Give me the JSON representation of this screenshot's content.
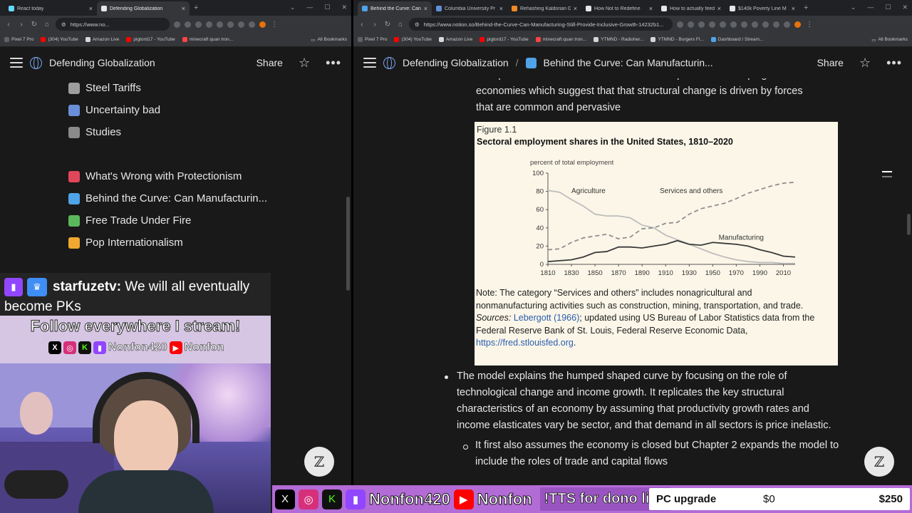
{
  "left_browser": {
    "tabs": [
      {
        "title": "React today",
        "color": "#61dafb",
        "active": false
      },
      {
        "title": "Defending Globalization",
        "color": "#e6e6e6",
        "active": true
      }
    ],
    "url": "https://www.no...",
    "bookmarks": [
      "Pixel 7 Pro",
      "(304) YouTube",
      "Amazon Live",
      "pigtord17 - YouTube",
      "minecraft quan tron..."
    ],
    "all_bookmarks": "All Bookmarks"
  },
  "right_browser": {
    "tabs": [
      {
        "title": "Behind the Curve: Can",
        "color": "#4fa3e8",
        "active": true
      },
      {
        "title": "Columbia University Pr",
        "color": "#5f8fd8",
        "active": false
      },
      {
        "title": "Rehashing Kaldorian G",
        "color": "#f08a24",
        "active": false
      },
      {
        "title": "How Not to Redefine",
        "color": "#e6e6e6",
        "active": false
      },
      {
        "title": "How to actually feed A",
        "color": "#e6e6e6",
        "active": false
      },
      {
        "title": "$140k Poverty Line M",
        "color": "#e6e6e6",
        "active": false
      }
    ],
    "url": "https://www.notion.so/Behind-the-Curve-Can-Manufacturing-Still-Provide-Inclusive-Growth-14232b1...",
    "bookmarks": [
      "Pixel 7 Pro",
      "(304) YouTube",
      "Amazon Live",
      "pigtord17 - YouTube",
      "minecraft quan tron...",
      "YTMND - Radioher...",
      "YTMND - Burgers Fl...",
      "Dashboard / Stream..."
    ],
    "all_bookmarks": "All Bookmarks"
  },
  "left_notion": {
    "header": {
      "title": "Defending Globalization",
      "share": "Share"
    },
    "nav": [
      {
        "label": "Steel Tariffs",
        "icon": "chain-icon",
        "color": "#9e9e9e"
      },
      {
        "label": "Uncertainty bad",
        "icon": "bar-chart-icon",
        "color": "#6a8fd8"
      },
      {
        "label": "Studies",
        "icon": "checker-icon",
        "color": "#8a8a8a"
      },
      {
        "label": "What's Wrong with Protectionism",
        "icon": "red-book-icon",
        "color": "#e0475a"
      },
      {
        "label": "Behind the Curve: Can Manufacturin...",
        "icon": "blue-book-icon",
        "color": "#4fa3e8"
      },
      {
        "label": "Free Trade Under Fire",
        "icon": "green-book-icon",
        "color": "#5cb85c"
      },
      {
        "label": "Pop Internationalism",
        "icon": "orange-book-icon",
        "color": "#f0a830"
      }
    ]
  },
  "right_notion": {
    "header": {
      "breadcrumb_root": "Defending Globalization",
      "breadcrumb_page": "Behind the Curve: Can Manufacturin...",
      "share": "Share"
    },
    "para_top": [
      "This pattern is observed in almost all developed and developing",
      "economies which suggest that that structural change is driven by forces",
      "that are common and pervasive"
    ],
    "figure": {
      "label": "Figure 1.1",
      "title": "Sectoral employment shares in the United States, 1810–2020",
      "note": "Note: The category “Services and others” includes nonagricultural and nonmanufacturing activities such as construction, mining, transportation, and trade.",
      "sources_label": "Sources:",
      "sources_link": "Lebergott (1966)",
      "sources_text": "; updated using US Bureau of Labor Statistics data from the Federal Reserve Bank of St. Louis, Federal Reserve Economic Data,",
      "url": "https://fred.stlouisfed.org",
      "url_end": "."
    },
    "bullet1": "The model explains the humped shaped curve by focusing on the role of technological change and income growth. It replicates the key structural characteristics of an economy by assuming that productivity growth rates and income elasticates vary be sector, and that demand in all sectors is price inelastic.",
    "bullet2": "It first also assumes the economy is closed but Chapter 2 expands the model to include the roles of trade and capital flows"
  },
  "chart_data": {
    "type": "line",
    "title": "Sectoral employment shares in the United States, 1810–2020",
    "ylabel": "percent of total employment",
    "xlabel": "",
    "ylim": [
      0,
      100
    ],
    "xlim": [
      1810,
      2020
    ],
    "xticks": [
      1810,
      1830,
      1850,
      1870,
      1890,
      1910,
      1930,
      1950,
      1970,
      1990,
      2010
    ],
    "yticks": [
      0,
      20,
      40,
      60,
      80,
      100
    ],
    "series": [
      {
        "name": "Agriculture",
        "style": "solid",
        "color": "#bdbdbd",
        "x": [
          1810,
          1820,
          1830,
          1840,
          1850,
          1860,
          1870,
          1880,
          1890,
          1900,
          1910,
          1920,
          1930,
          1940,
          1950,
          1960,
          1970,
          1980,
          1990,
          2000,
          2010,
          2020
        ],
        "values": [
          81,
          79,
          71,
          64,
          55,
          53,
          53,
          51,
          43,
          40,
          32,
          27,
          22,
          17,
          12,
          8,
          5,
          3,
          2,
          2,
          1,
          1
        ]
      },
      {
        "name": "Services and others",
        "style": "dashed",
        "color": "#8f8f8f",
        "x": [
          1810,
          1820,
          1830,
          1840,
          1850,
          1860,
          1870,
          1880,
          1890,
          1900,
          1910,
          1920,
          1930,
          1940,
          1950,
          1960,
          1970,
          1980,
          1990,
          2000,
          2010,
          2020
        ],
        "values": [
          16,
          17,
          24,
          29,
          31,
          33,
          28,
          30,
          39,
          40,
          45,
          46,
          55,
          61,
          64,
          67,
          72,
          78,
          82,
          86,
          89,
          90
        ]
      },
      {
        "name": "Manufacturing",
        "style": "solid",
        "color": "#3a3a3a",
        "x": [
          1810,
          1820,
          1830,
          1840,
          1850,
          1860,
          1870,
          1880,
          1890,
          1900,
          1910,
          1920,
          1930,
          1940,
          1950,
          1960,
          1970,
          1980,
          1990,
          2000,
          2010,
          2020
        ],
        "values": [
          3,
          4,
          5,
          8,
          13,
          14,
          19,
          19,
          18,
          20,
          22,
          26,
          22,
          21,
          24,
          23,
          22,
          20,
          16,
          13,
          9,
          8
        ]
      }
    ],
    "grid": false
  },
  "stream": {
    "chat_user": "starfuzetv:",
    "chat_message": "We will all eventually become PKs",
    "follow_text": "Follow everywhere I stream!",
    "handle1": "Nonfon420",
    "handle2": "Nonfon",
    "tts": "!TTS for dono link",
    "goal_label": "PC upgrade",
    "goal_current": "$0",
    "goal_target": "$250"
  },
  "colors": {
    "notion_bg": "#191919",
    "chrome_tab": "#35363a",
    "overlay_purple": "#b36bd6",
    "twitch": "#9146ff",
    "youtube": "#ff0000",
    "kick": "#53fc18"
  }
}
